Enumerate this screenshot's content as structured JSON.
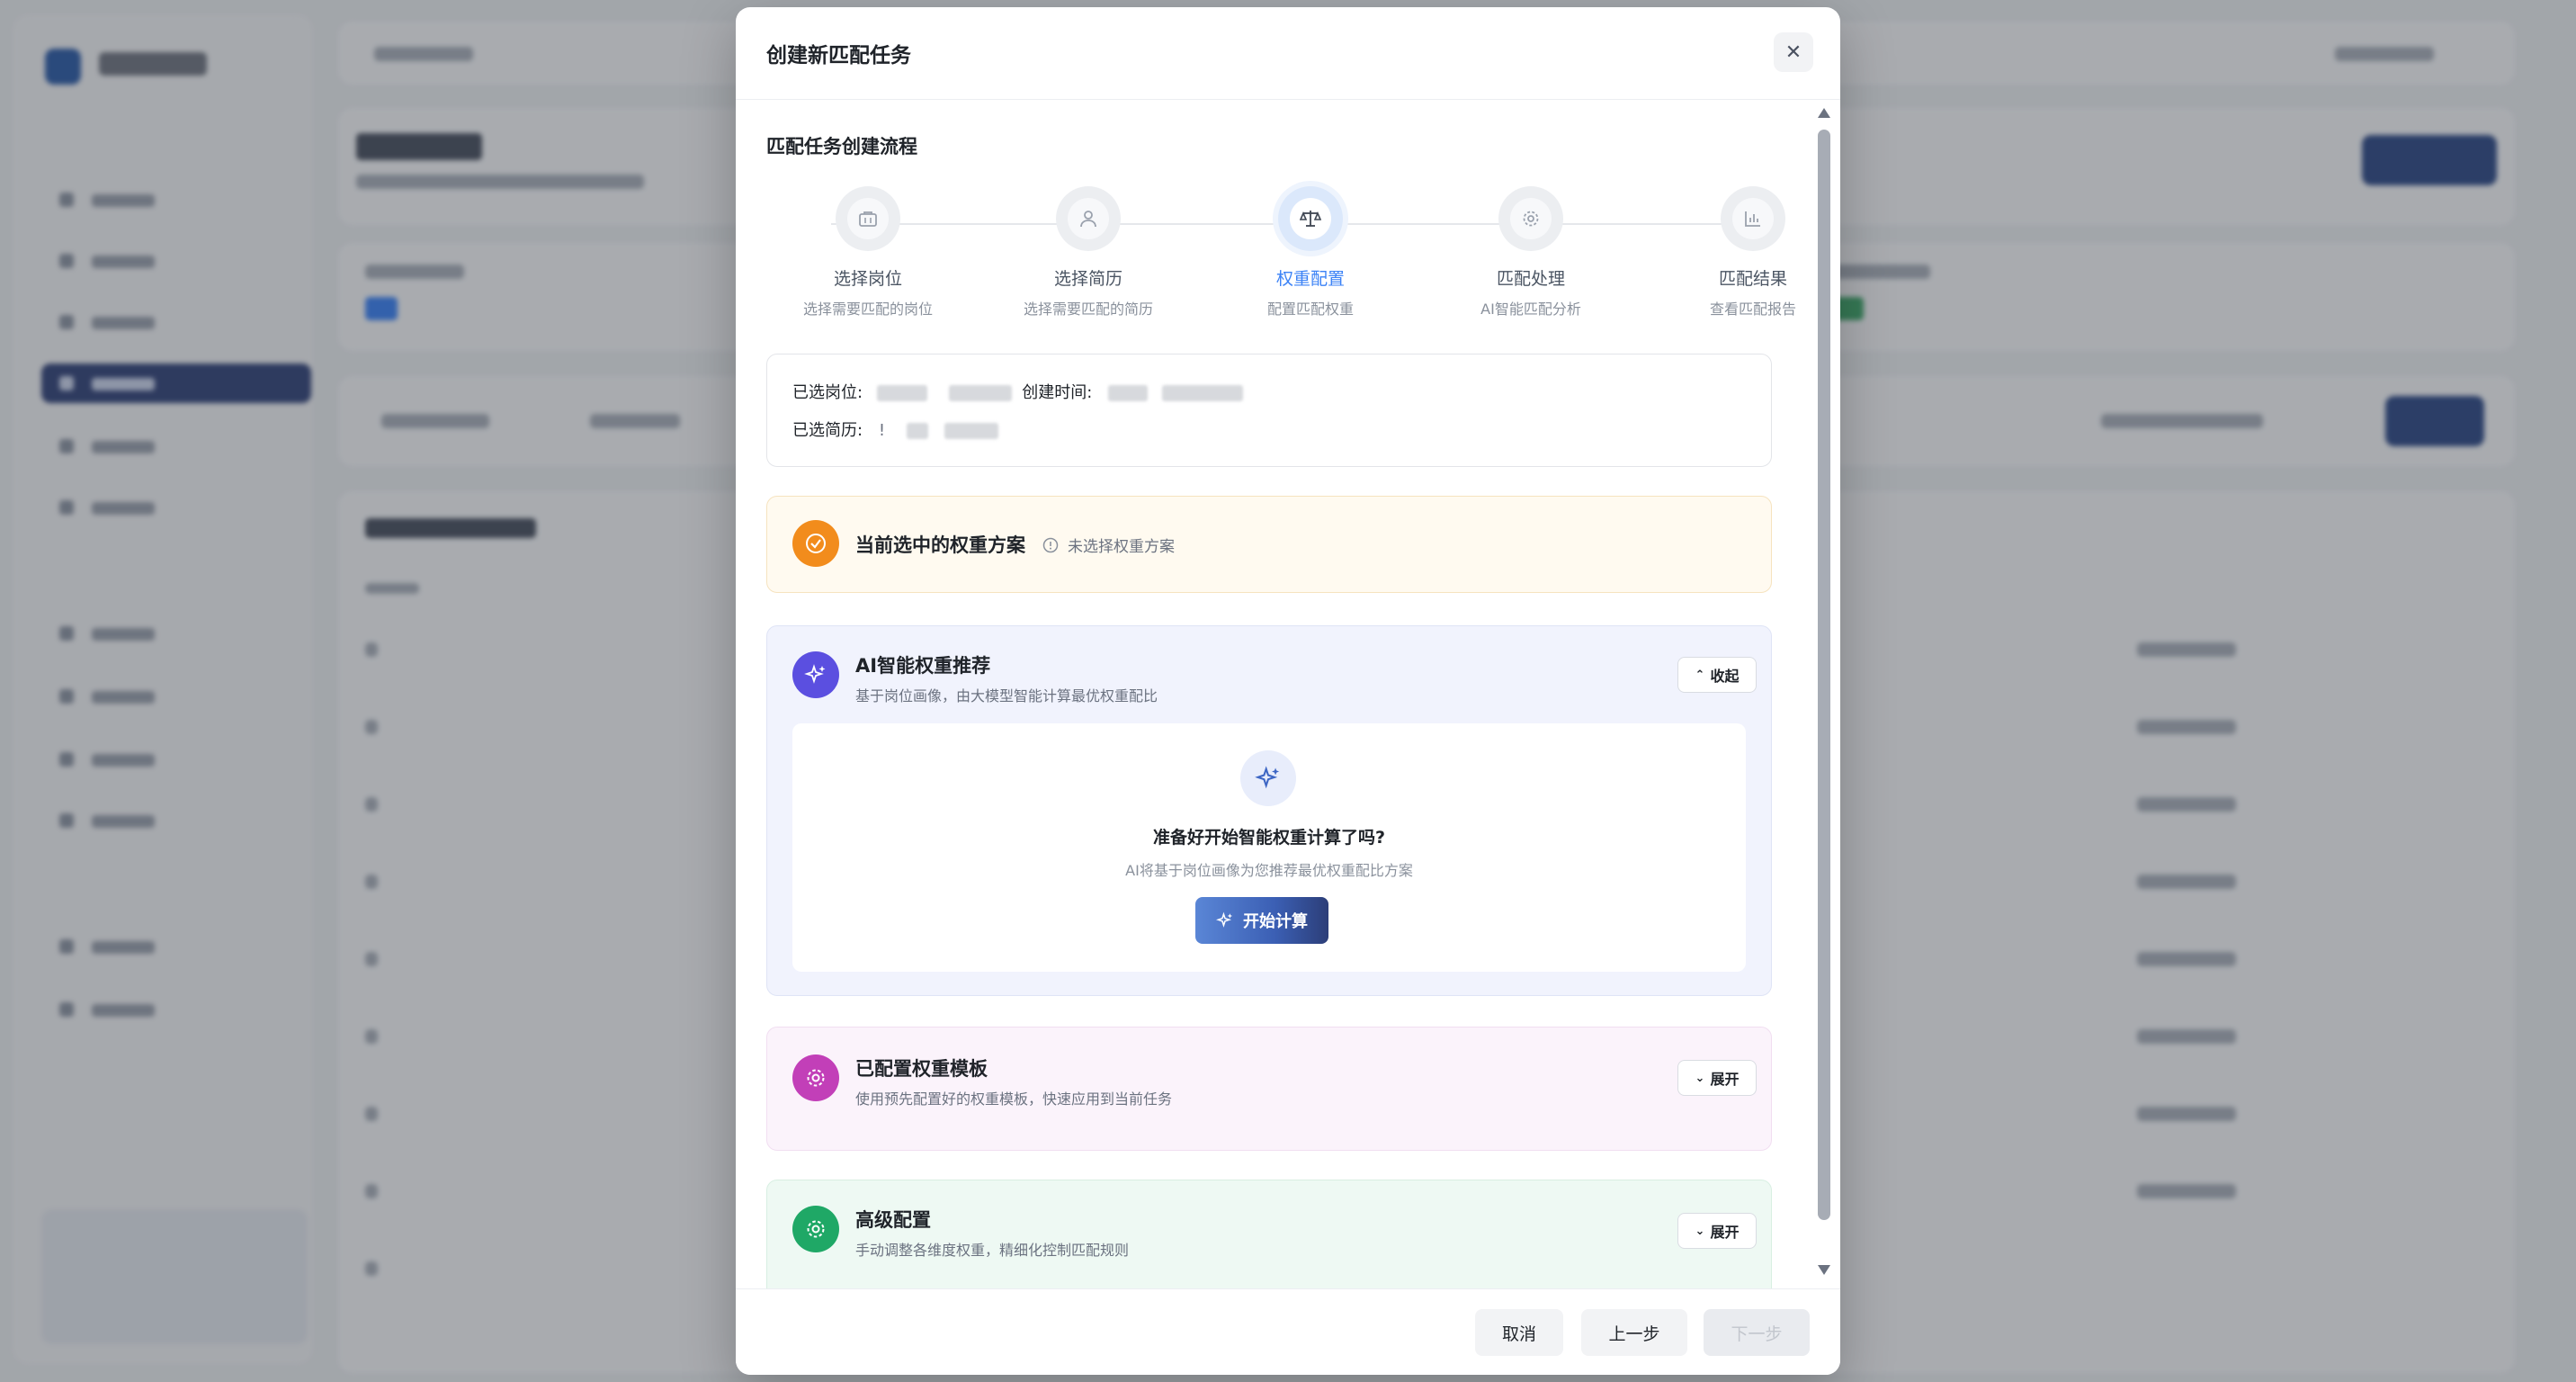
{
  "modal": {
    "title": "创建新匹配任务",
    "close_glyph": "✕",
    "flow_title": "匹配任务创建流程",
    "steps": [
      {
        "label": "选择岗位",
        "sub": "选择需要匹配的岗位",
        "icon": "briefcase-icon",
        "active": false
      },
      {
        "label": "选择简历",
        "sub": "选择需要匹配的简历",
        "icon": "user-icon",
        "active": false
      },
      {
        "label": "权重配置",
        "sub": "配置匹配权重",
        "icon": "scale-icon",
        "active": true
      },
      {
        "label": "匹配处理",
        "sub": "AI智能匹配分析",
        "icon": "gear-icon",
        "active": false
      },
      {
        "label": "匹配结果",
        "sub": "查看匹配报告",
        "icon": "bar-chart-icon",
        "active": false
      }
    ],
    "info": {
      "position_label": "已选岗位:",
      "created_label": "创建时间:",
      "resume_label": "已选简历:",
      "resume_mark": "!"
    },
    "current_scheme": {
      "title": "当前选中的权重方案",
      "status": "未选择权重方案"
    },
    "ai_section": {
      "title": "AI智能权重推荐",
      "subtitle": "基于岗位画像，由大模型智能计算最优权重配比",
      "toggle_label": "收起",
      "prompt_title": "准备好开始智能权重计算了吗?",
      "prompt_sub": "AI将基于岗位画像为您推荐最优权重配比方案",
      "start_label": "开始计算"
    },
    "template_section": {
      "title": "已配置权重模板",
      "subtitle": "使用预先配置好的权重模板，快速应用到当前任务",
      "toggle_label": "展开"
    },
    "advanced_section": {
      "title": "高级配置",
      "subtitle": "手动调整各维度权重，精细化控制匹配规则",
      "toggle_label": "展开"
    },
    "footer": {
      "cancel_label": "取消",
      "prev_label": "上一步",
      "next_label": "下一步"
    }
  },
  "colors": {
    "accent_blue": "#3b82f6",
    "orange": "#f28c1c",
    "purple": "#5b4fe0",
    "magenta": "#c23fb8",
    "green": "#1fa866"
  }
}
